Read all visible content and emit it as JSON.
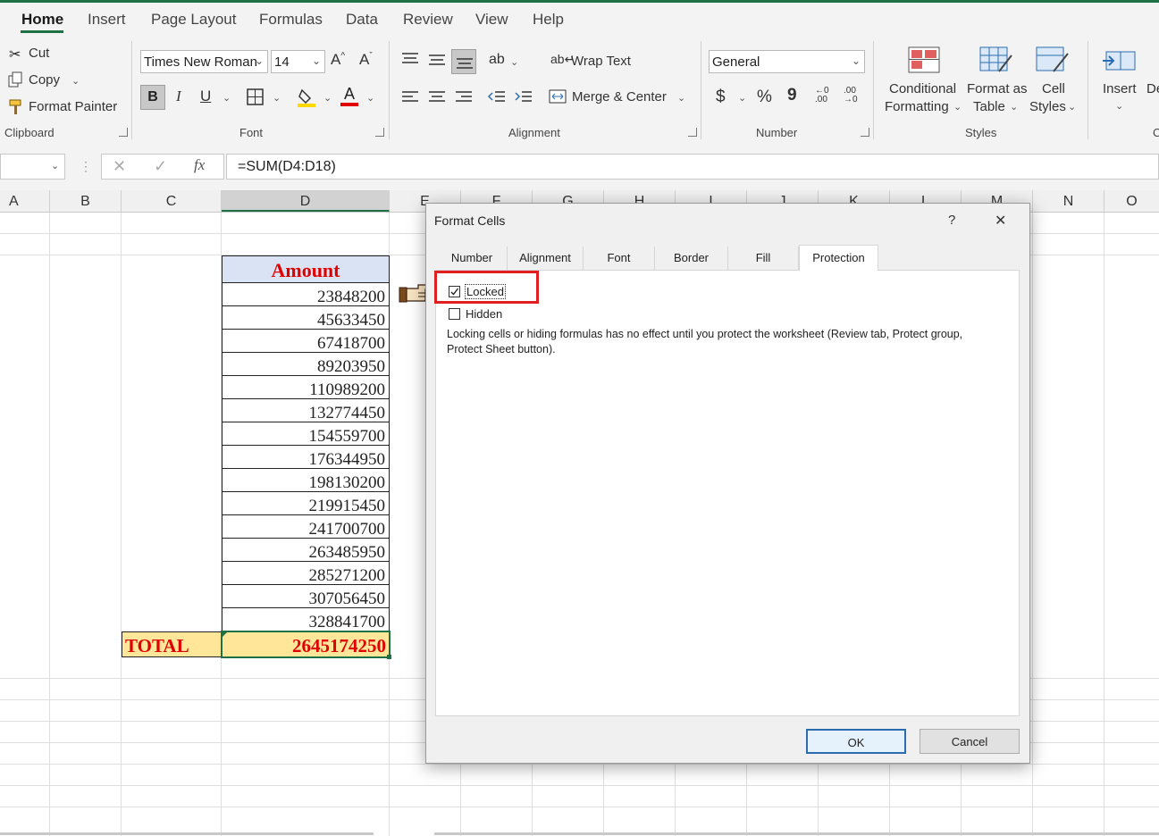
{
  "ribbon": {
    "tabs": [
      "Home",
      "Insert",
      "Page Layout",
      "Formulas",
      "Data",
      "Review",
      "View",
      "Help"
    ],
    "clipboard": {
      "cut": "Cut",
      "copy": "Copy",
      "format_painter": "Format Painter",
      "group": "Clipboard"
    },
    "font": {
      "name": "Times New Roman",
      "size": "14",
      "group": "Font",
      "bold": "B",
      "italic": "I",
      "underline": "U"
    },
    "alignment": {
      "wrap_text": "Wrap Text",
      "merge_center": "Merge & Center",
      "group": "Alignment"
    },
    "number": {
      "format": "General",
      "group": "Number",
      "currency": "$",
      "percent": "%",
      "comma": "9",
      "inc_decimal": ".00",
      "dec_decimal": ".00"
    },
    "styles": {
      "conditional_1": "Conditional",
      "conditional_2": "Formatting",
      "format_table_1": "Format as",
      "format_table_2": "Table",
      "cell_styles_1": "Cell",
      "cell_styles_2": "Styles",
      "group": "Styles"
    },
    "cells": {
      "insert": "Insert",
      "delete_partial": "De",
      "group_partial": "C"
    }
  },
  "formula_bar": {
    "formula": "=SUM(D4:D18)",
    "fx": "fx"
  },
  "columns": [
    "A",
    "B",
    "C",
    "D",
    "E",
    "F",
    "G",
    "H",
    "I",
    "J",
    "K",
    "L",
    "M",
    "N",
    "O"
  ],
  "sheet": {
    "header": "Amount",
    "values": [
      "23848200",
      "45633450",
      "67418700",
      "89203950",
      "110989200",
      "132774450",
      "154559700",
      "176344950",
      "198130200",
      "219915450",
      "241700700",
      "263485950",
      "285271200",
      "307056450",
      "328841700"
    ],
    "total_label": "TOTAL",
    "total_value": "2645174250"
  },
  "dialog": {
    "title": "Format Cells",
    "help": "?",
    "close": "✕",
    "tabs": [
      "Number",
      "Alignment",
      "Font",
      "Border",
      "Fill",
      "Protection"
    ],
    "active_tab": "Protection",
    "locked_label": "Locked",
    "locked_checked": true,
    "hidden_label": "Hidden",
    "hidden_checked": false,
    "note_line1": "Locking cells or hiding formulas has no effect until you protect the worksheet (Review tab, Protect group,",
    "note_line2": "Protect Sheet button).",
    "ok": "OK",
    "cancel": "Cancel"
  },
  "colors": {
    "accent_green": "#1e7145",
    "header_fill": "#dae3f3",
    "total_fill": "#ffe699",
    "red_text": "#e00000",
    "highlight_box": "#e02020"
  },
  "icons": [
    "cut-icon",
    "copy-icon",
    "format-painter-icon",
    "pointing-hand-icon",
    "checkmark-icon"
  ]
}
